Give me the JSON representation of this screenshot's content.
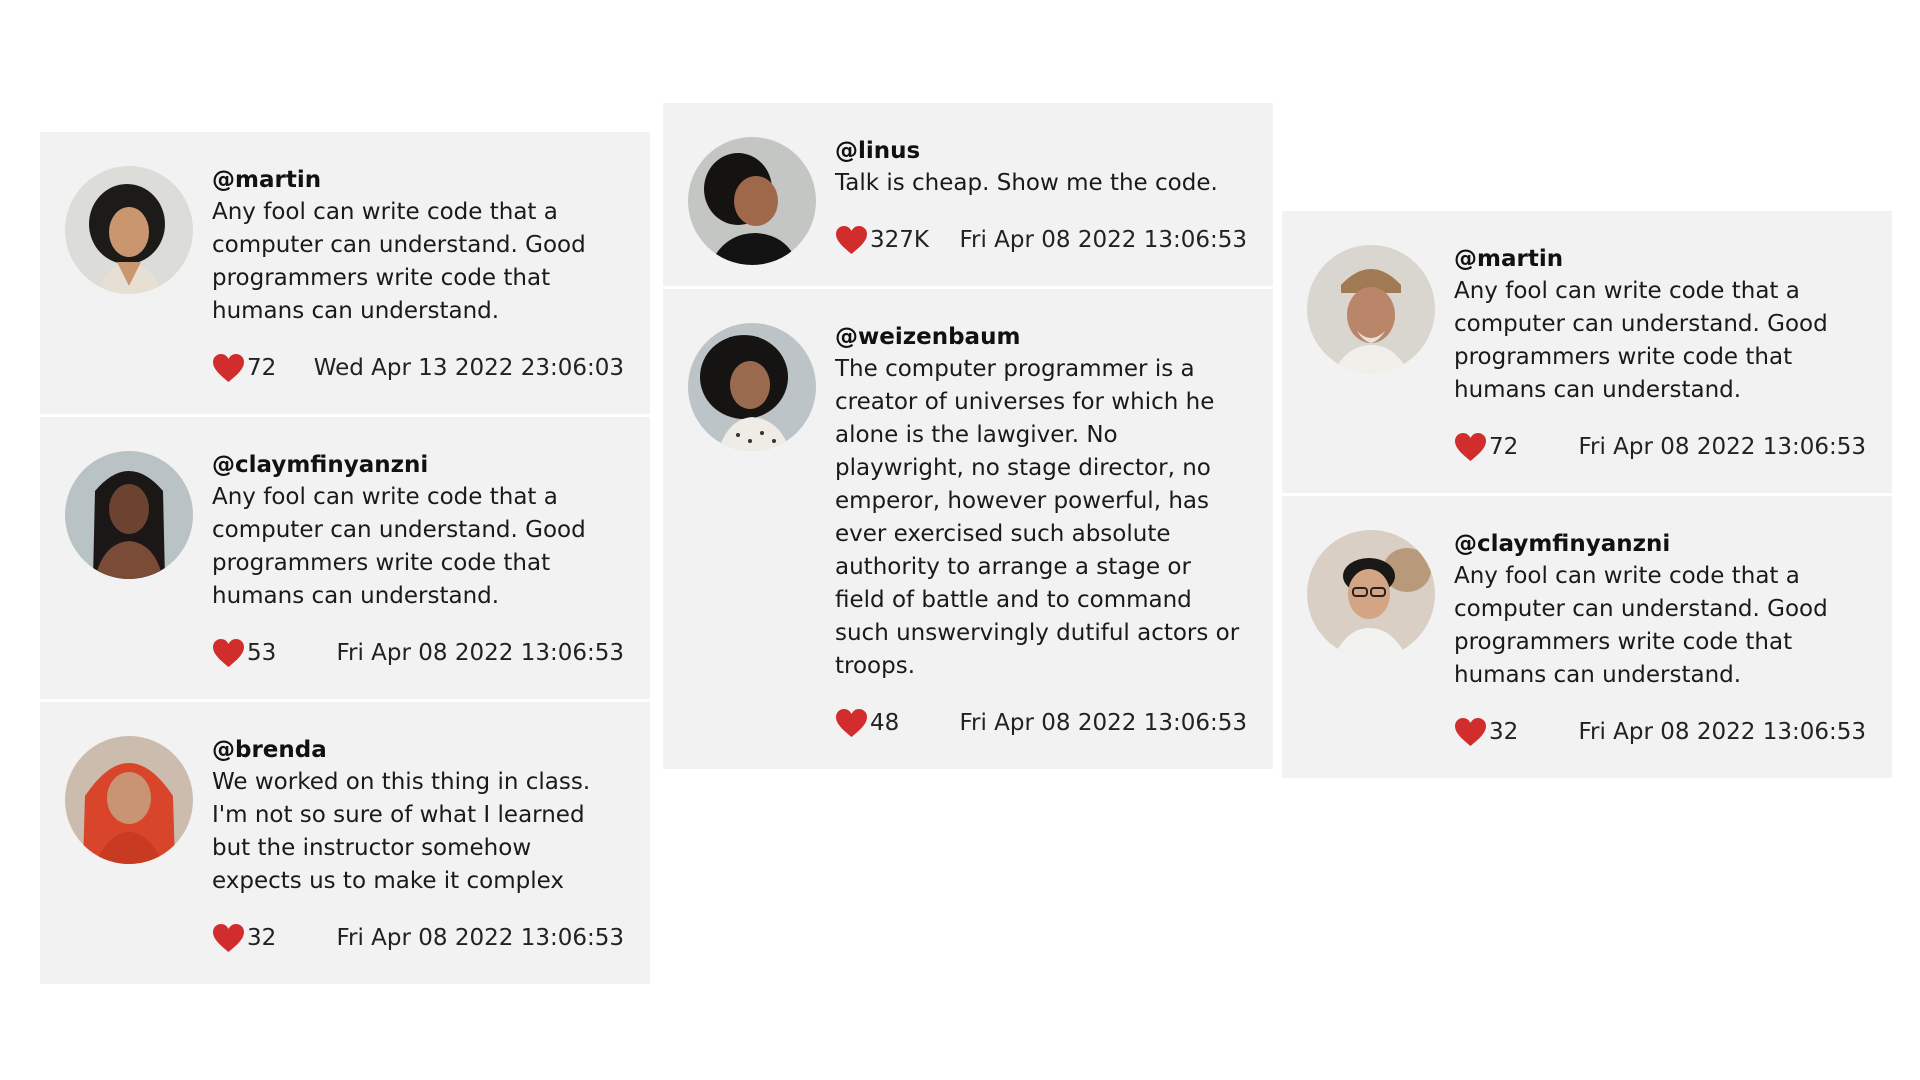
{
  "colors": {
    "card_background": "#f2f2f2",
    "page_background": "#ffffff",
    "heart": "#d22d2d",
    "text": "#111111"
  },
  "columns": [
    {
      "cards": [
        {
          "handle": "@martin",
          "text": "Any fool can write code that a computer can understand. Good programmers write code that humans can understand.",
          "likes": "72",
          "timestamp": "Wed Apr 13 2022 23:06:03",
          "avatar": "woman-curly-hair-avatar"
        },
        {
          "handle": "@claymfinyanzni",
          "text": "Any fool can write code that a computer can understand. Good programmers write code that humans can understand.",
          "likes": "53",
          "timestamp": "Fri Apr 08 2022 13:06:53",
          "avatar": "woman-braids-avatar"
        },
        {
          "handle": "@brenda",
          "text": "We worked on this thing in class. I'm not so sure of what I learned but the instructor somehow expects us to make it complex",
          "likes": "32",
          "timestamp": "Fri Apr 08 2022 13:06:53",
          "avatar": "woman-hijab-avatar"
        }
      ]
    },
    {
      "cards": [
        {
          "handle": "@linus",
          "text": "Talk is cheap. Show me the code.",
          "likes": "327K",
          "timestamp": "Fri Apr 08 2022 13:06:53",
          "avatar": "woman-laughing-avatar"
        },
        {
          "handle": "@weizenbaum",
          "text": "The computer programmer is a creator of universes for which he alone is the lawgiver. No playwright, no stage director, no emperor, however powerful, has ever exercised such absolute authority to arrange a stage or field of battle and to command such unswervingly dutiful actors or troops.",
          "likes": "48",
          "timestamp": "Fri Apr 08 2022 13:06:53",
          "avatar": "woman-curly-hair-smiling-avatar"
        }
      ]
    },
    {
      "cards": [
        {
          "handle": "@martin",
          "text": "Any fool can write code that a computer can understand. Good programmers write code that humans can understand.",
          "likes": "72",
          "timestamp": "Fri Apr 08 2022 13:06:53",
          "avatar": "man-kufi-cap-avatar"
        },
        {
          "handle": "@claymfinyanzni",
          "text": "Any fool can write code that a computer can understand. Good programmers write code that humans can understand.",
          "likes": "32",
          "timestamp": "Fri Apr 08 2022 13:06:53",
          "avatar": "man-glasses-avatar"
        }
      ]
    }
  ]
}
